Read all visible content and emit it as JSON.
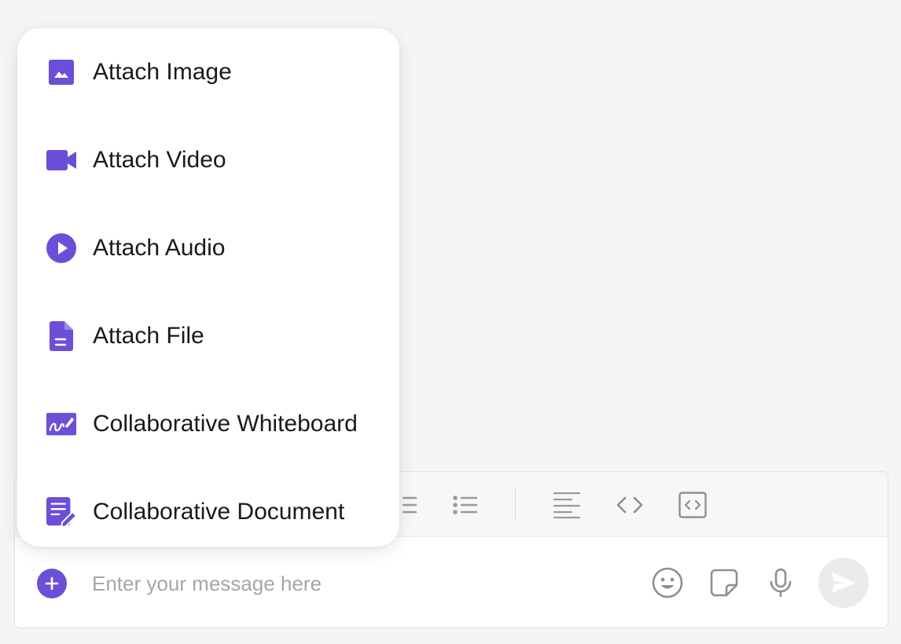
{
  "accent_color": "#6b4fd8",
  "menu": {
    "items": [
      {
        "label": "Attach Image",
        "icon": "image-icon"
      },
      {
        "label": "Attach Video",
        "icon": "video-icon"
      },
      {
        "label": "Attach Audio",
        "icon": "audio-play-icon"
      },
      {
        "label": "Attach File",
        "icon": "file-icon"
      },
      {
        "label": "Collaborative Whiteboard",
        "icon": "whiteboard-icon"
      },
      {
        "label": "Collaborative Document",
        "icon": "document-edit-icon"
      }
    ]
  },
  "toolbar": {
    "buttons": [
      "ordered-list-icon",
      "bulleted-list-icon",
      "align-left-icon",
      "code-icon",
      "code-block-icon"
    ]
  },
  "composer": {
    "placeholder": "Enter your message here",
    "value": "",
    "actions": [
      "add-icon",
      "emoji-icon",
      "sticker-icon",
      "microphone-icon",
      "send-icon"
    ]
  }
}
